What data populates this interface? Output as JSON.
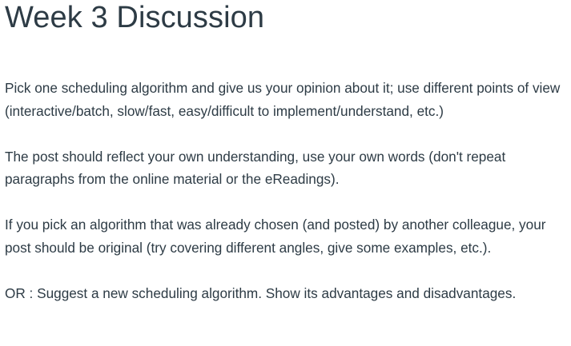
{
  "page": {
    "title": "Week 3 Discussion"
  },
  "content": {
    "paragraphs": [
      "Pick one scheduling algorithm and give us your opinion about it; use different points of view (interactive/batch, slow/fast, easy/difficult to implement/understand, etc.)",
      "The post should reflect your own understanding, use your own words (don't repeat paragraphs from the online material or the eReadings).",
      "If you pick an algorithm that was already chosen (and posted) by another colleague, your post should be original (try covering different angles, give some examples, etc.).",
      "OR : Suggest a new scheduling algorithm. Show its advantages and disadvantages."
    ]
  }
}
